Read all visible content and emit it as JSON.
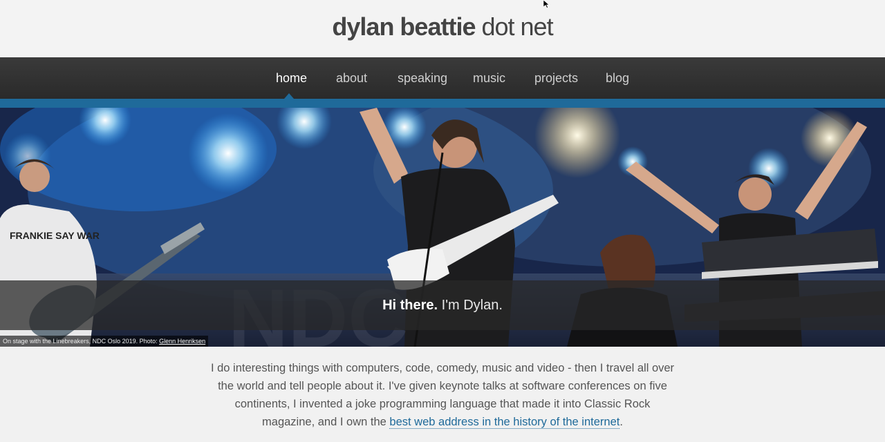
{
  "header": {
    "title_bold": "dylan beattie",
    "title_light": "dot net"
  },
  "nav": {
    "items": [
      {
        "label": "home",
        "active": true
      },
      {
        "label": "about"
      },
      {
        "label": "speaking"
      },
      {
        "label": "music"
      },
      {
        "label": "projects"
      },
      {
        "label": "blog"
      }
    ]
  },
  "hero": {
    "greeting_bold": "Hi there.",
    "greeting_rest": " I'm Dylan.",
    "credit_text": "On stage with the Linebreakers, NDC Oslo 2019. Photo: ",
    "credit_link": "Glenn Henriksen",
    "shirt_text": "FRANKIE SAY WAR"
  },
  "intro": {
    "text": "I do interesting things with computers, code, comedy, music and video - then I travel all over the world and tell people about it. I've given keynote talks at software conferences on five continents, I invented a joke programming language that made it into Classic Rock magazine, and I own the ",
    "link": "best web address in the history of the internet",
    "tail": "."
  },
  "colors": {
    "accent": "#1f6a9a",
    "nav_bg": "#333333",
    "page_bg": "#f1f1f1"
  }
}
